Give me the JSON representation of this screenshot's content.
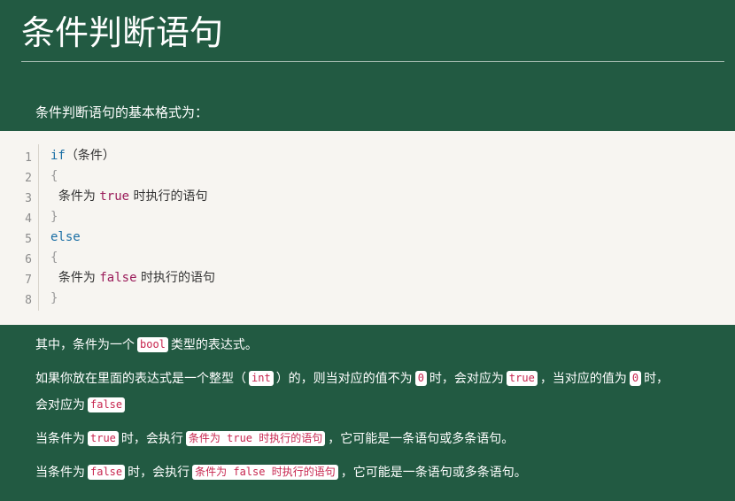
{
  "title": "条件判断语句",
  "intro": "条件判断语句的基本格式为：",
  "code": {
    "line_numbers": [
      "1",
      "2",
      "3",
      "4",
      "5",
      "6",
      "7",
      "8"
    ],
    "line1_kw": "if",
    "line1_rest": "（条件）",
    "open_brace": "{",
    "close_brace": "}",
    "line3_pre": "  条件为 ",
    "line3_val": "true",
    "line3_post": " 时执行的语句",
    "line5_kw": "else",
    "line7_pre": "  条件为 ",
    "line7_val": "false",
    "line7_post": " 时执行的语句"
  },
  "p1": {
    "a": "其中，条件为一个",
    "code": "bool",
    "b": "类型的表达式。"
  },
  "p2": {
    "a": "如果你放在里面的表达式是一个整型（",
    "code1": "int",
    "b": "）的，则当对应的值不为",
    "code2": "0",
    "c": "时，会对应为",
    "code3": "true",
    "d": "，当对应的值为",
    "code4": "0",
    "e": "时，",
    "f": "会对应为",
    "code5": "false"
  },
  "p3": {
    "a": "当条件为",
    "code1": "true",
    "b": "时，会执行",
    "code2": "条件为 true 时执行的语句",
    "c": "，它可能是一条语句或多条语句。"
  },
  "p4": {
    "a": "当条件为",
    "code1": "false",
    "b": "时，会执行",
    "code2": "条件为 false 时执行的语句",
    "c": "，它可能是一条语句或多条语句。"
  }
}
